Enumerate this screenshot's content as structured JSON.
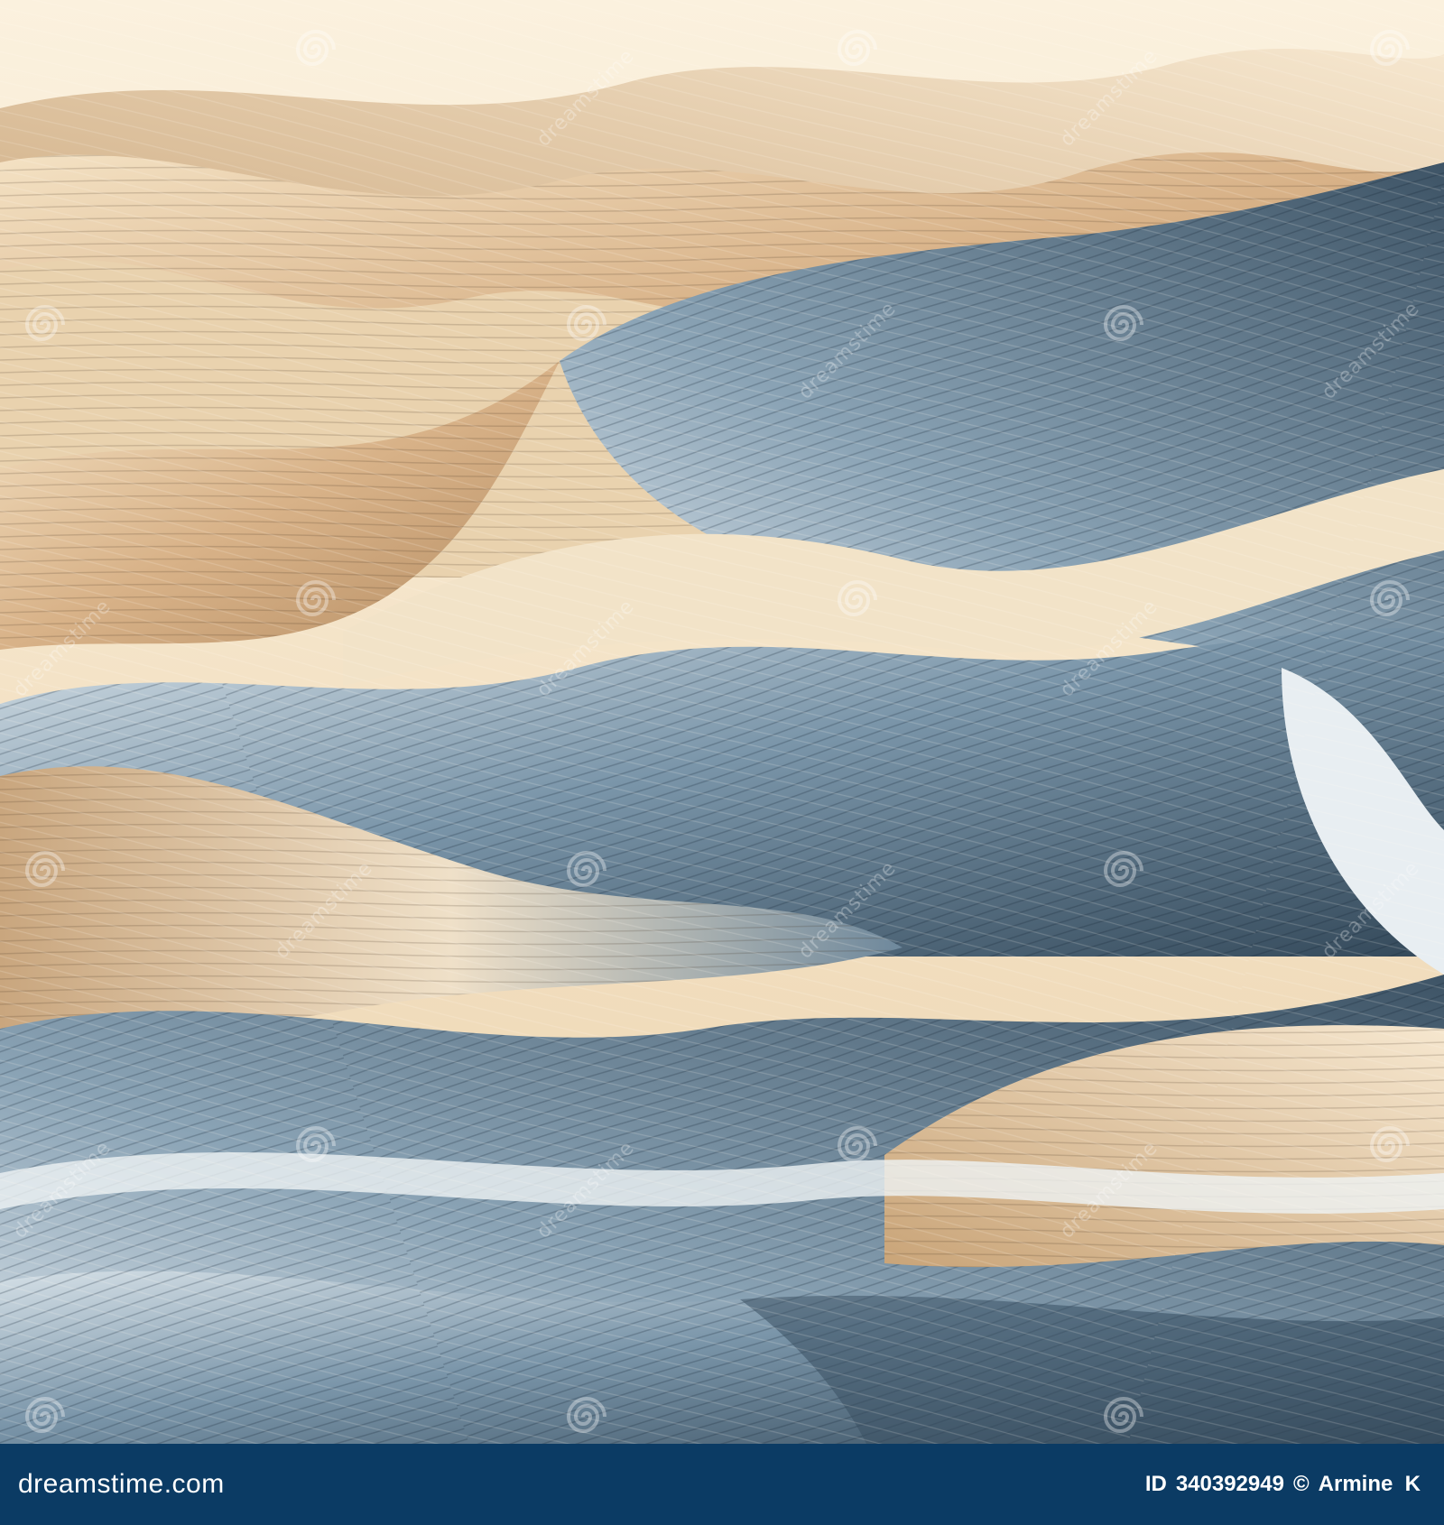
{
  "watermark": {
    "text": "dreamstime"
  },
  "footer": {
    "logo_text": "dreamstime.com",
    "id_label": "ID",
    "id_number": "340392949",
    "copyright_symbol": "©",
    "author": "Armine  K"
  },
  "colors": {
    "footer_bg": "#0b3b64",
    "sand_light": "#f3e4cb",
    "sand_mid": "#d9b88f",
    "sand_dark": "#a8845c",
    "blue_light": "#c8d6e0",
    "blue_mid": "#6f8ba0",
    "blue_dark": "#2f4556"
  }
}
